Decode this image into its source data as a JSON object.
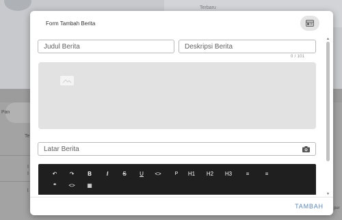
{
  "background": {
    "tab_text": "Terbaru",
    "side_labels": [
      "Pan",
      "Te",
      "I",
      "I",
      "l"
    ],
    "footer_text": "per"
  },
  "modal": {
    "title": "Form Tambah Berita",
    "header_icon": "calendar-card-icon",
    "fields": {
      "judul_placeholder": "Judul Berita",
      "deskripsi_placeholder": "Deskripsi Berita",
      "counter": "0 / 101",
      "latar_placeholder": "Latar Berita"
    },
    "image_placeholder_icon": "image-icon",
    "camera_icon": "camera-icon",
    "toolbar": {
      "row1": [
        "↶",
        "↷",
        "B",
        "I",
        "S",
        "U",
        "<>",
        "P",
        "H1",
        "H2",
        "H3",
        "≡",
        "≡"
      ],
      "row2": [
        "❝",
        "<>",
        "▦"
      ]
    },
    "submit_label": "TAMBAH",
    "colors": {
      "accent": "#5a86b6",
      "toolbar_bg": "#1f1f1f"
    }
  }
}
